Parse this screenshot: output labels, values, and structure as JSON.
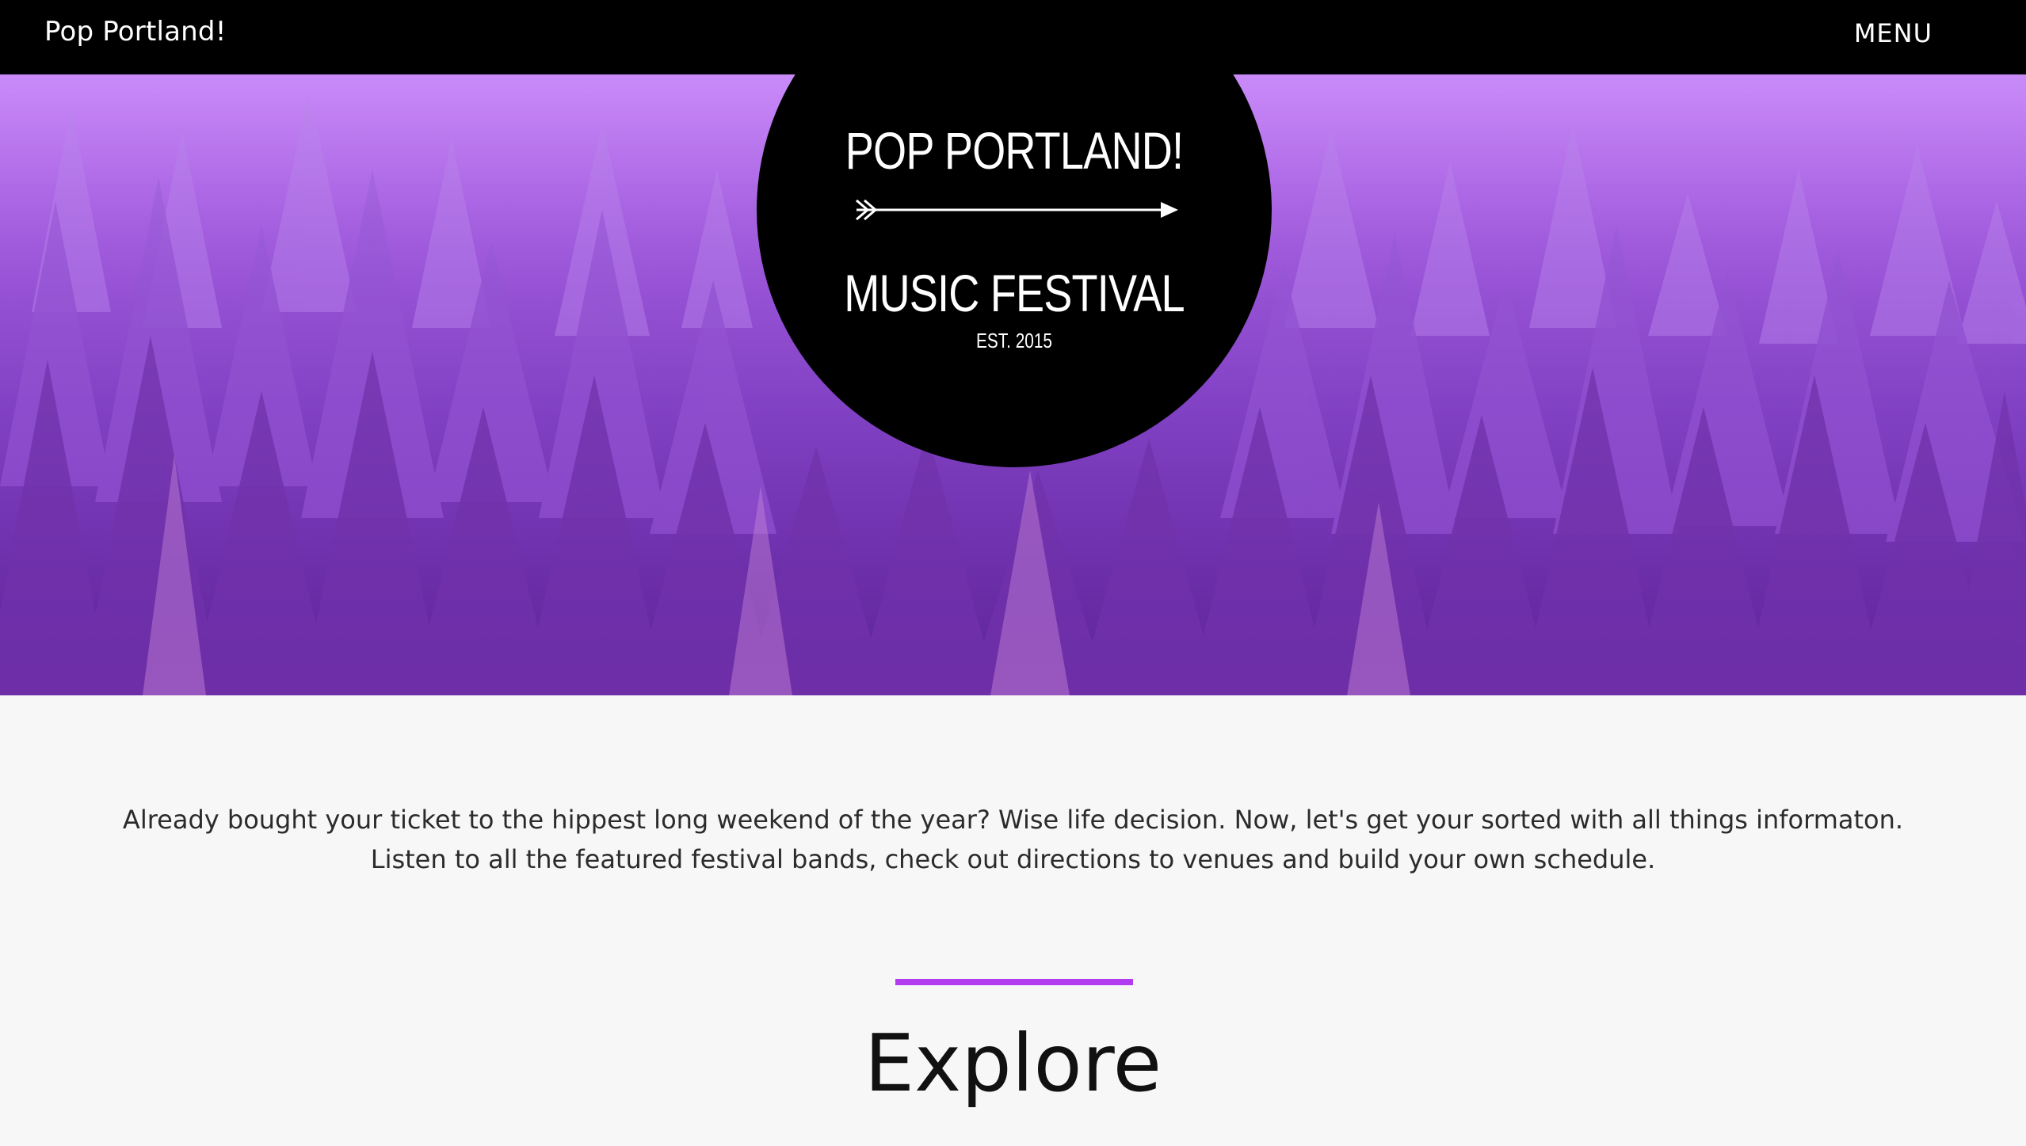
{
  "nav": {
    "brand": "Pop Portland!",
    "menu_label": "MENU"
  },
  "hero": {
    "badge_title": "POP PORTLAND!",
    "badge_subtitle": "MUSIC FESTIVAL",
    "badge_est": "EST. 2015"
  },
  "content": {
    "intro_text": "Already bought your ticket to the hippest long weekend of the year? Wise life decision. Now, let's get your sorted with all things informaton. Listen to all the featured festival bands, check out directions to venues and build your own schedule.",
    "section_heading": "Explore"
  },
  "colors": {
    "accent": "#b43cf0",
    "hero_purple": "#8a48cf",
    "nav_bg": "#000000",
    "page_bg": "#f7f7f7"
  },
  "icons": {
    "badge_arrow": "arrow-icon",
    "hero_background": "forest-image"
  }
}
